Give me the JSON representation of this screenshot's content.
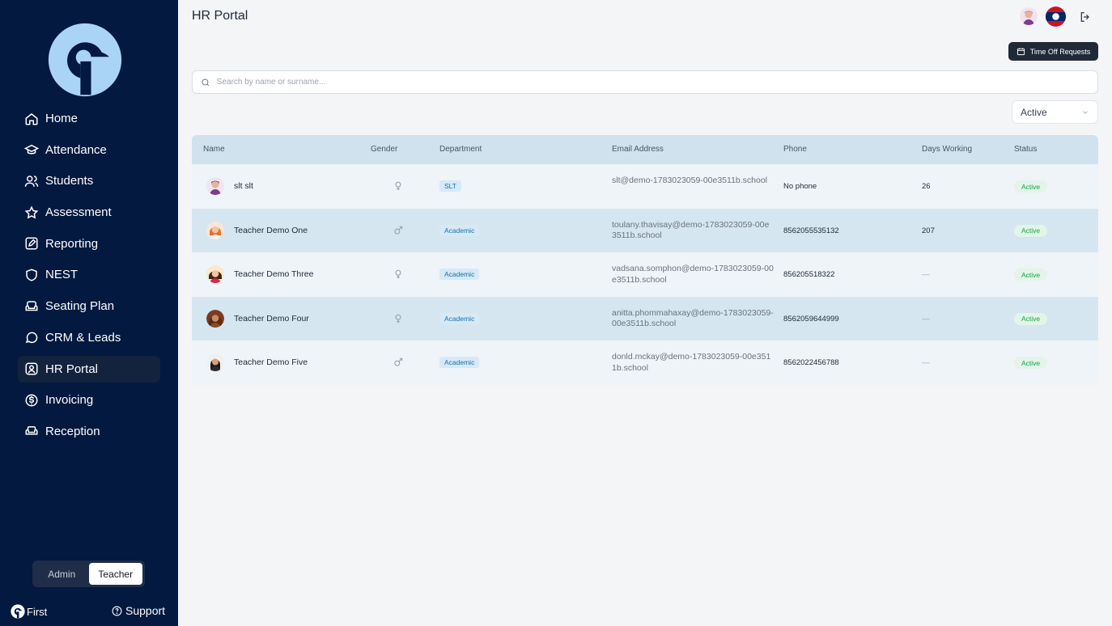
{
  "sidebar": {
    "items": [
      {
        "label": "Home",
        "icon": "home-icon"
      },
      {
        "label": "Attendance",
        "icon": "graduation-cap-icon"
      },
      {
        "label": "Students",
        "icon": "users-icon"
      },
      {
        "label": "Assessment",
        "icon": "star-icon"
      },
      {
        "label": "Reporting",
        "icon": "edit-icon"
      },
      {
        "label": "NEST",
        "icon": "shield-icon"
      },
      {
        "label": "Seating Plan",
        "icon": "armchair-icon"
      },
      {
        "label": "CRM & Leads",
        "icon": "chat-bubble-icon"
      },
      {
        "label": "HR Portal",
        "icon": "user-square-icon",
        "active": true
      },
      {
        "label": "Invoicing",
        "icon": "dollar-circle-icon"
      },
      {
        "label": "Reception",
        "icon": "sofa-icon"
      }
    ],
    "roles": {
      "admin": "Admin",
      "teacher": "Teacher",
      "active": "Teacher"
    },
    "brand": "First",
    "support": "Support"
  },
  "header": {
    "title": "HR Portal",
    "time_off_label": "Time Off Requests"
  },
  "search": {
    "placeholder": "Search by name or surname...",
    "value": ""
  },
  "filter": {
    "selected": "Active"
  },
  "table": {
    "columns": [
      "Name",
      "Gender",
      "Department",
      "Email Address",
      "Phone",
      "Days Working",
      "Status"
    ],
    "rows": [
      {
        "name": "slt slt",
        "gender": "female",
        "department": "SLT",
        "email": "slt@demo-1783023059-00e3511b.school",
        "phone": "No phone",
        "days": "26",
        "status": "Active"
      },
      {
        "name": "Teacher Demo One",
        "gender": "male",
        "department": "Academic",
        "email": "toulany.thavisay@demo-1783023059-00e3511b.school",
        "phone": "8562055535132",
        "days": "207",
        "status": "Active"
      },
      {
        "name": "Teacher Demo Three",
        "gender": "female",
        "department": "Academic",
        "email": "vadsana.somphon@demo-1783023059-00e3511b.school",
        "phone": "856205518322",
        "days": "—",
        "status": "Active"
      },
      {
        "name": "Teacher Demo Four",
        "gender": "female",
        "department": "Academic",
        "email": "anitta.phommahaxay@demo-1783023059-00e3511b.school",
        "phone": "8562059644999",
        "days": "—",
        "status": "Active"
      },
      {
        "name": "Teacher Demo Five",
        "gender": "male",
        "department": "Academic",
        "email": "donld.mckay@demo-1783023059-00e3511b.school",
        "phone": "8562022456788",
        "days": "—",
        "status": "Active"
      }
    ]
  },
  "colors": {
    "sidebar_bg": "#03193f",
    "accent_light": "#cfe2ee",
    "status_green": "#16a34a"
  }
}
